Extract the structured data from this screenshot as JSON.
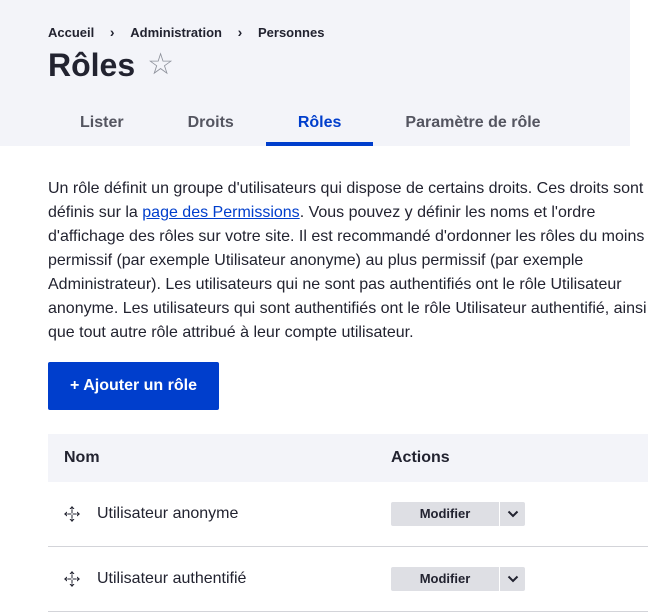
{
  "breadcrumb": {
    "items": [
      "Accueil",
      "Administration",
      "Personnes"
    ],
    "separator": "›"
  },
  "page": {
    "title": "Rôles",
    "star_icon": "☆"
  },
  "tabs": [
    {
      "label": "Lister",
      "active": false
    },
    {
      "label": "Droits",
      "active": false
    },
    {
      "label": "Rôles",
      "active": true
    },
    {
      "label": "Paramètre de rôle",
      "active": false
    }
  ],
  "description": {
    "before_link": "Un rôle définit un groupe d'utilisateurs qui dispose de certains droits. Ces droits sont définis sur la ",
    "link_text": "page des Permissions",
    "after_link": ". Vous pouvez y définir les noms et l'ordre d'affichage des rôles sur votre site. Il est recommandé d'ordonner les rôles du moins permissif (par exemple Utilisateur anonyme) au plus permissif (par exemple Administrateur). Les utilisateurs qui ne sont pas authentifiés ont le rôle Utilisateur anonyme. Les utilisateurs qui sont authentifiés ont le rôle Utilisateur authentifié, ainsi que tout autre rôle attribué à leur compte utilisateur."
  },
  "add_button": {
    "label": "+ Ajouter un rôle"
  },
  "table": {
    "headers": {
      "name": "Nom",
      "actions": "Actions"
    },
    "rows": [
      {
        "name": "Utilisateur anonyme",
        "action": "Modifier"
      },
      {
        "name": "Utilisateur authentifié",
        "action": "Modifier"
      }
    ]
  },
  "colors": {
    "accent": "#003ecc",
    "header_bg": "#f3f4f9",
    "button_secondary_bg": "#dedfe4"
  }
}
